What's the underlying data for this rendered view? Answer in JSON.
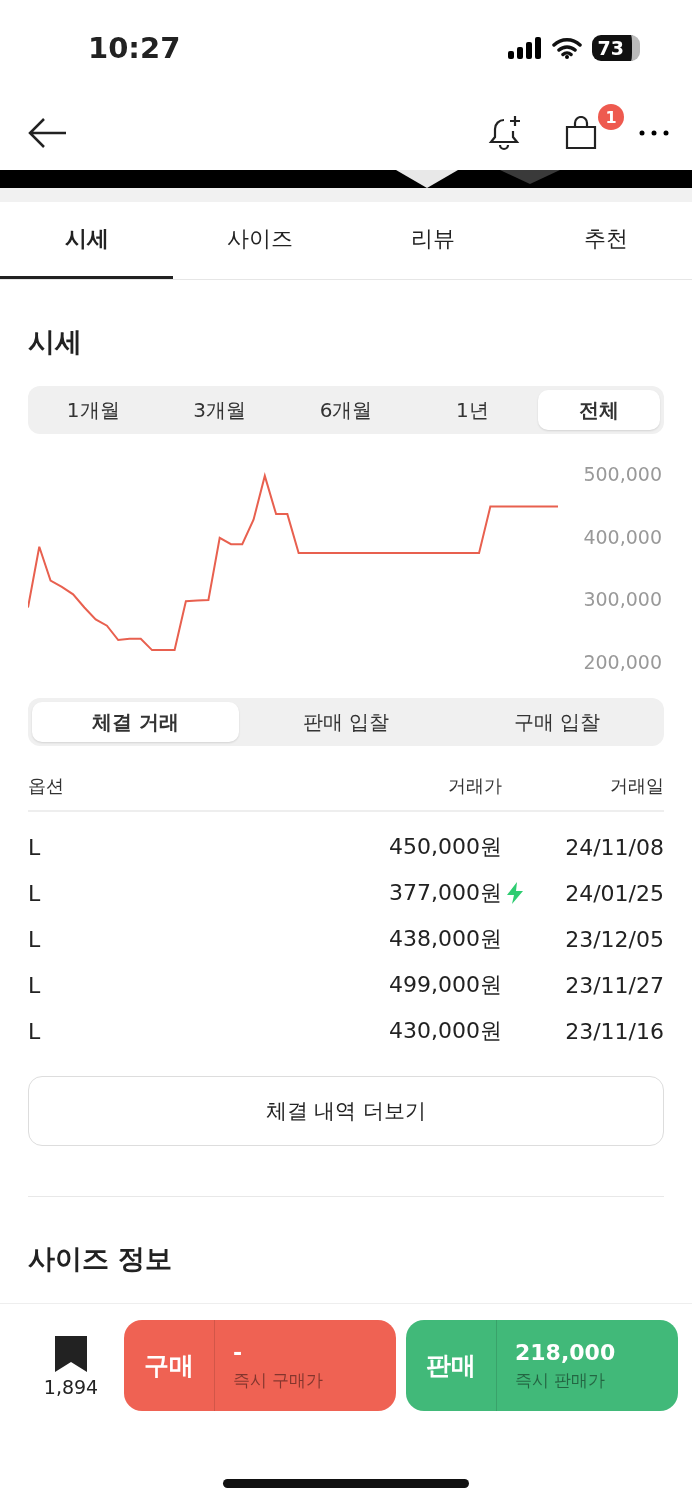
{
  "status_bar": {
    "time": "10:27",
    "battery": "73"
  },
  "header": {
    "cart_badge": "1"
  },
  "tabs": [
    {
      "label": "시세",
      "selected": true
    },
    {
      "label": "사이즈",
      "selected": false
    },
    {
      "label": "리뷰",
      "selected": false
    },
    {
      "label": "추천",
      "selected": false
    }
  ],
  "price_section": {
    "title": "시세",
    "periods": [
      {
        "label": "1개월",
        "selected": false
      },
      {
        "label": "3개월",
        "selected": false
      },
      {
        "label": "6개월",
        "selected": false
      },
      {
        "label": "1년",
        "selected": false
      },
      {
        "label": "전체",
        "selected": true
      }
    ],
    "chart_data": {
      "type": "line",
      "ylim": [
        200000,
        500000
      ],
      "yticks": [
        {
          "value": 500000,
          "label": "500,000"
        },
        {
          "value": 400000,
          "label": "400,000"
        },
        {
          "value": 300000,
          "label": "300,000"
        },
        {
          "value": 200000,
          "label": "200,000"
        }
      ],
      "series": [
        {
          "color": "#e8604f",
          "values": [
            287000,
            384000,
            330000,
            320000,
            308000,
            287000,
            268000,
            258000,
            235000,
            237000,
            237000,
            219000,
            219000,
            219000,
            297000,
            298000,
            299000,
            398000,
            388000,
            388000,
            427000,
            497000,
            436000,
            436000,
            374000,
            374000,
            374000,
            374000,
            374000,
            374000,
            374000,
            374000,
            374000,
            374000,
            374000,
            374000,
            374000,
            374000,
            374000,
            374000,
            374000,
            448000,
            448000,
            448000,
            448000,
            448000,
            448000,
            448000
          ]
        }
      ]
    }
  },
  "trade_tabs": [
    {
      "label": "체결 거래",
      "selected": true
    },
    {
      "label": "판매 입찰",
      "selected": false
    },
    {
      "label": "구매 입찰",
      "selected": false
    }
  ],
  "table": {
    "columns": [
      "옵션",
      "거래가",
      "거래일"
    ],
    "rows": [
      {
        "option": "L",
        "price": "450,000원",
        "date": "24/11/08",
        "quick": false
      },
      {
        "option": "L",
        "price": "377,000원",
        "date": "24/01/25",
        "quick": true
      },
      {
        "option": "L",
        "price": "438,000원",
        "date": "23/12/05",
        "quick": false
      },
      {
        "option": "L",
        "price": "499,000원",
        "date": "23/11/27",
        "quick": false
      },
      {
        "option": "L",
        "price": "430,000원",
        "date": "23/11/16",
        "quick": false
      }
    ]
  },
  "more_button": "체결 내역 더보기",
  "size_section": {
    "title": "사이즈 정보"
  },
  "bottom_bar": {
    "bookmark_count": "1,894",
    "buy": {
      "label": "구매",
      "price": "-",
      "caption": "즉시 구매가"
    },
    "sell": {
      "label": "판매",
      "price": "218,000",
      "caption": "즉시 판매가"
    }
  }
}
